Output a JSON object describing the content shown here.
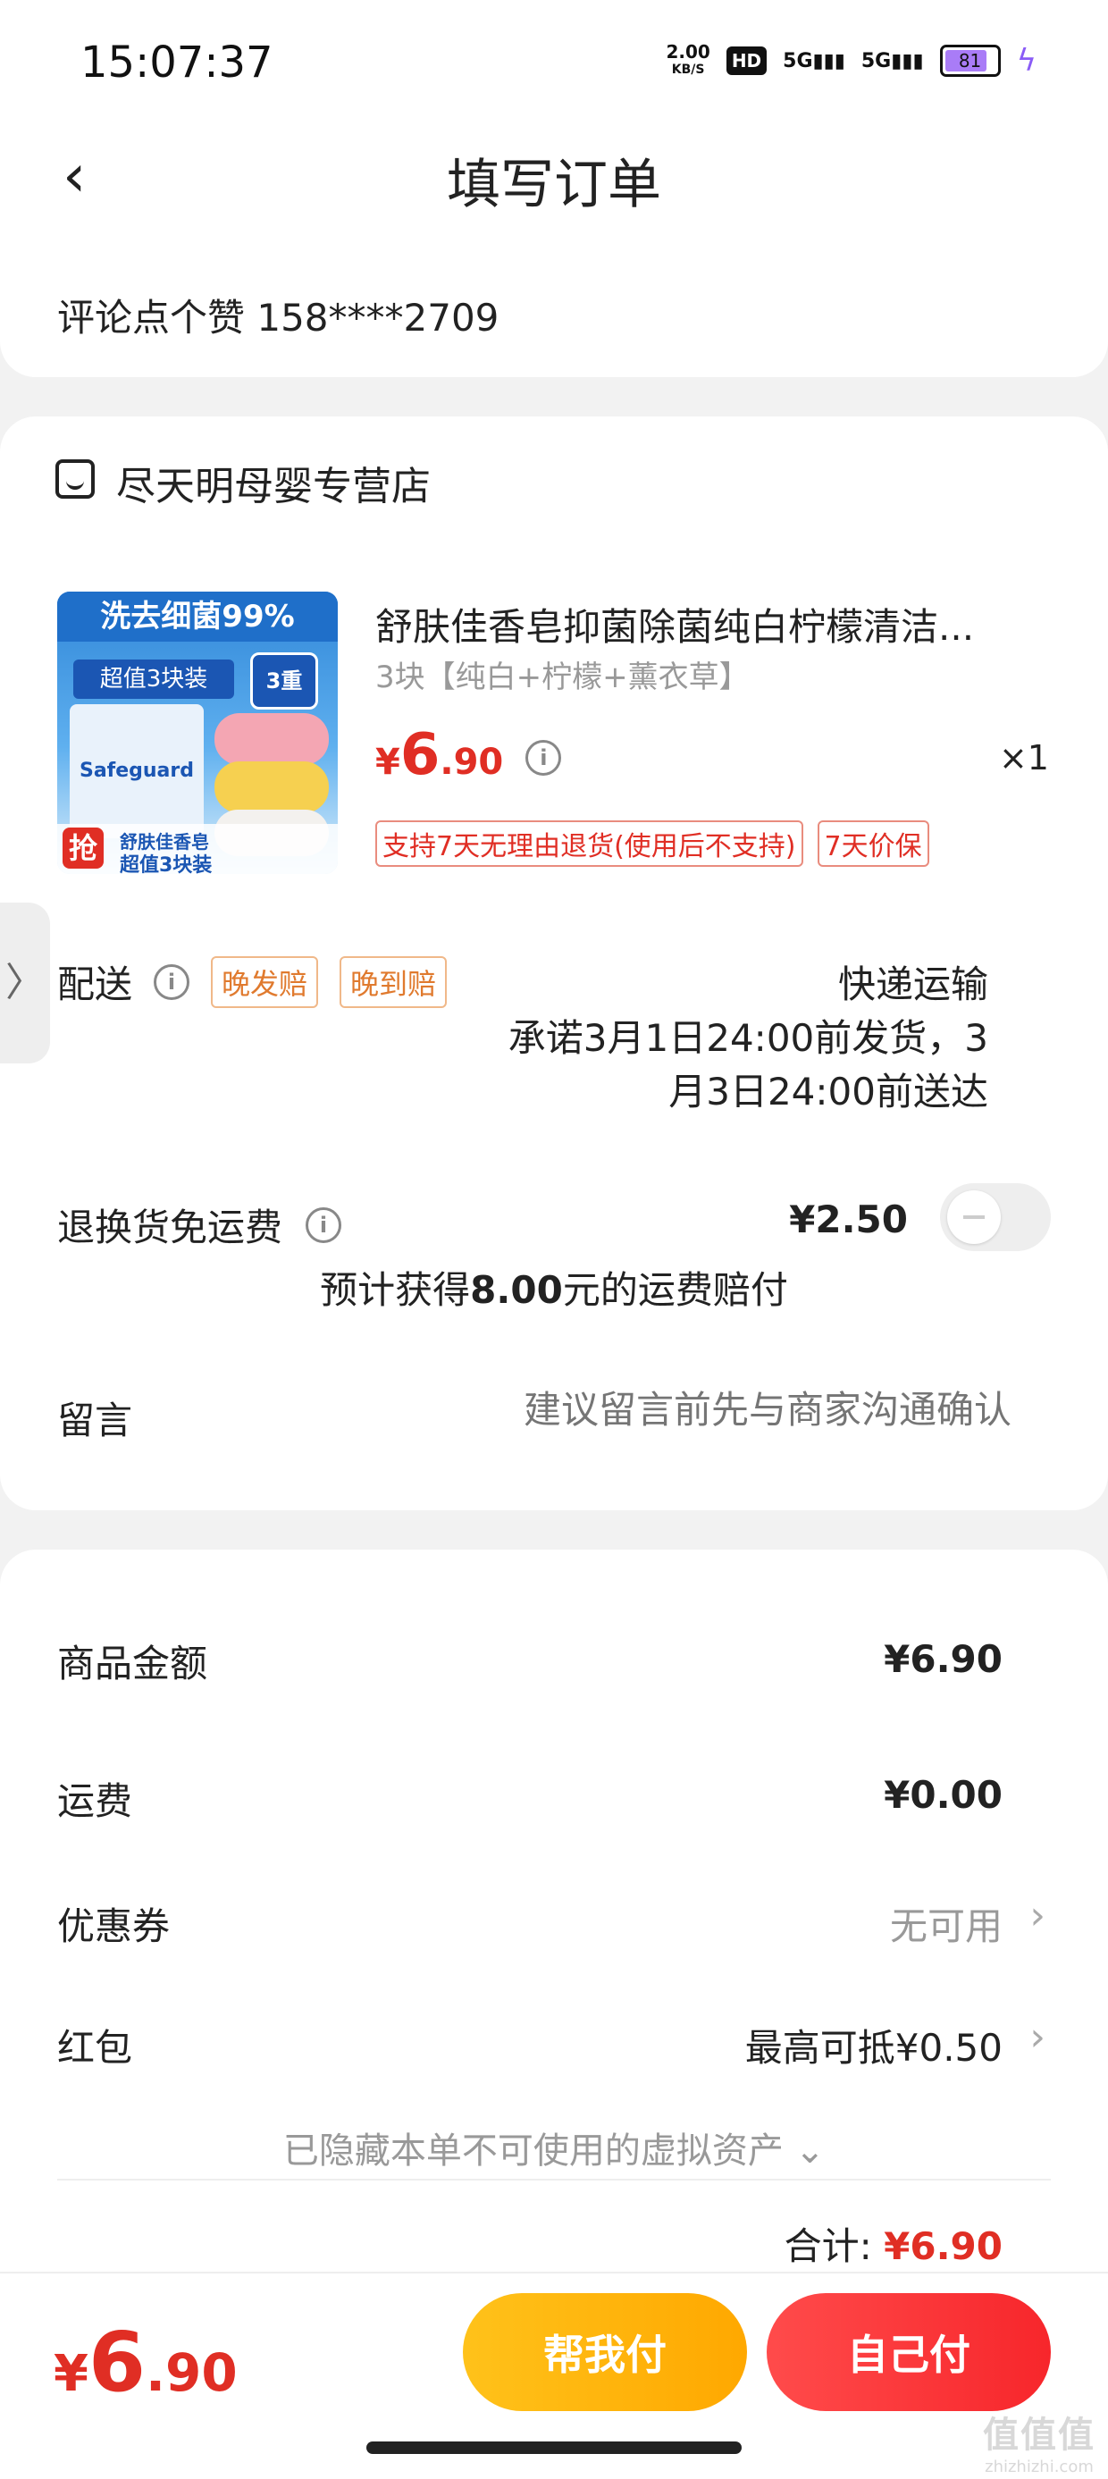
{
  "status_bar": {
    "time": "15:07:37",
    "net_speed_value": "2.00",
    "net_speed_unit": "KB/S",
    "hd_label": "HD",
    "signal_1": "5G",
    "signal_2": "5G",
    "battery": "81"
  },
  "header": {
    "title": "填写订单",
    "back_icon": "chevron-left-icon"
  },
  "address": {
    "contact_line": "评论点个赞  158****2709"
  },
  "store": {
    "icon": "store-icon",
    "name": "尽天明母婴专营店"
  },
  "product": {
    "image_banner_text": "洗去细菌99%",
    "image_pack_text": "超值3块装",
    "image_brand": "Safeguard",
    "image_badge": "3重",
    "image_cta": "抢",
    "image_caption_1": "舒肤佳香皂",
    "image_caption_2": "超值3块装",
    "title": "舒肤佳香皂抑菌除菌纯白柠檬清洁...",
    "sku": "3块【纯白+柠檬+薰衣草】",
    "price_currency": "¥",
    "price_int": "6",
    "price_dec": ".90",
    "quantity": "×1",
    "tags": [
      "支持7天无理由退货(使用后不支持)",
      "7天价保"
    ]
  },
  "shipping": {
    "label": "配送",
    "tags": [
      "晚发赔",
      "晚到赔"
    ],
    "method": "快递运输",
    "promise": "承诺3月1日24:00前发货，3月3日24:00前送达"
  },
  "return_shipping": {
    "label": "退换货免运费",
    "price": "¥2.50",
    "compensation_prefix": "预计获得",
    "compensation_amount": "8.00",
    "compensation_suffix": "元的运费赔付",
    "toggle_on": false
  },
  "message": {
    "label": "留言",
    "placeholder": "建议留言前先与商家沟通确认"
  },
  "summary": {
    "goods_label": "商品金额",
    "goods_value": "¥6.90",
    "freight_label": "运费",
    "freight_value": "¥0.00",
    "coupon_label": "优惠券",
    "coupon_value": "无可用",
    "redpacket_label": "红包",
    "redpacket_value": "最高可抵¥0.50",
    "hidden_note": "已隐藏本单不可使用的虚拟资产",
    "total_label": "合计:",
    "total_value": "¥6.90"
  },
  "bottom_bar": {
    "price_currency": "¥",
    "price_int": "6",
    "price_dec": ".90",
    "help_pay": "帮我付",
    "self_pay": "自己付"
  },
  "watermark": {
    "text": "值值值",
    "sub": "zhizhizhi.com"
  },
  "colors": {
    "accent_red": "#e02e24",
    "help_button": "#ffb60d",
    "self_button": "#f7262b",
    "tag_orange": "#e07a2e"
  }
}
